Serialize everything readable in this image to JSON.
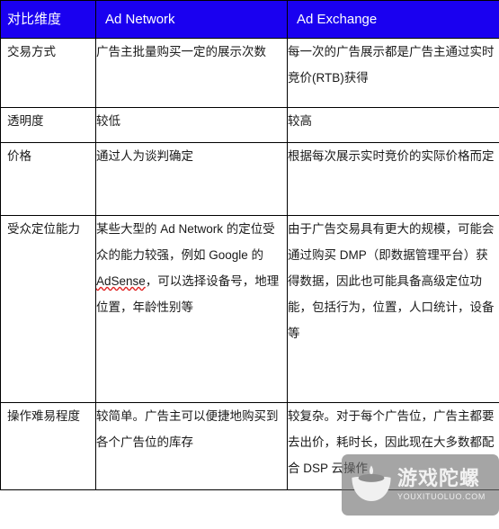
{
  "table": {
    "headers": [
      {
        "label": "对比维度"
      },
      {
        "label": "Ad Network"
      },
      {
        "label": "Ad Exchange"
      }
    ],
    "header_background": "#1a00f0",
    "header_text_color": "#ffffff",
    "border_color": "#000000",
    "rows": [
      {
        "key": "trade-method",
        "label": "交易方式",
        "ad_network": "广告主批量购买一定的展示次数",
        "ad_exchange": "每一次的广告展示都是广告主通过实时竞价(RTB)获得"
      },
      {
        "key": "transparency",
        "label": "透明度",
        "ad_network": "较低",
        "ad_exchange": "较高"
      },
      {
        "key": "price",
        "label": "价格",
        "ad_network": "通过人为谈判确定",
        "ad_exchange": "根据每次展示实时竞价的实际价格而定"
      },
      {
        "key": "audience-targeting",
        "label": "受众定位能力",
        "ad_network_parts": [
          {
            "text": "某些大型的 Ad Network 的定位受众的能力较强，例如 Google 的 ",
            "spellcheck": false
          },
          {
            "text": "AdSense",
            "spellcheck": true
          },
          {
            "text": "，可以选择设备号，地理位置，年龄性别等",
            "spellcheck": false
          }
        ],
        "ad_exchange": "由于广告交易具有更大的规模，可能会通过购买 DMP（即数据管理平台）获得数据，因此也可能具备高级定位功能，包括行为，位置，人口统计，设备等"
      },
      {
        "key": "operation-difficulty",
        "label": "操作难易程度",
        "ad_network": "较简单。广告主可以便捷地购买到各个广告位的库存",
        "ad_exchange": "较复杂。对于每个广告位，广告主都要去出价，耗时长，因此现在大多数都配合 DSP 云操作"
      }
    ]
  },
  "watermark": {
    "brand_cn": "游戏陀螺",
    "brand_en": "YOUXITUOLUO.COM",
    "background_color": "#6e6e6e",
    "text_color": "#f2f2f2"
  }
}
